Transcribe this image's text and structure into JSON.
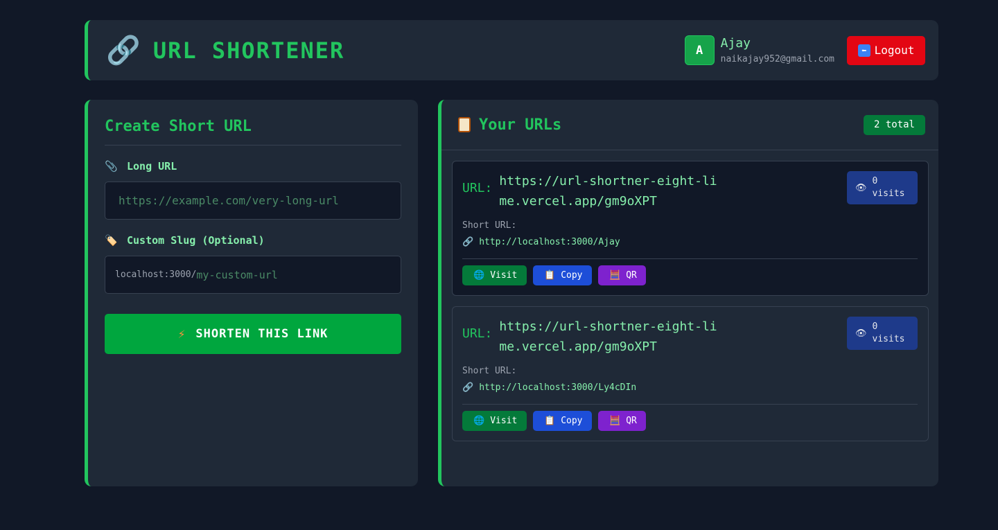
{
  "header": {
    "logo_icon": "🔗",
    "title": "URL SHORTENER",
    "user": {
      "avatar_initial": "A",
      "name": "Ajay",
      "email": "naikajay952@gmail.com"
    },
    "logout_label": "Logout",
    "logout_icon": "⬅"
  },
  "create": {
    "title": "Create Short URL",
    "long_url_label": "Long URL",
    "long_url_icon": "📎",
    "long_url_placeholder": "https://example.com/very-long-url",
    "slug_label": "Custom Slug (Optional)",
    "slug_icon": "🏷️",
    "slug_prefix": "localhost:3000/",
    "slug_placeholder": "my-custom-url",
    "submit_label": "SHORTEN THIS LINK",
    "submit_icon": "⚡"
  },
  "urls": {
    "title": "Your URLs",
    "total_badge": "2 total",
    "items": [
      {
        "url_prefix": "URL:",
        "long_url": "https://url-shortner-eight-lime.vercel.app/gm9oXPT",
        "visits_count": "0",
        "visits_label": "visits",
        "short_label": "Short URL:",
        "short_url": "http://localhost:3000/Ajay",
        "visit_label": "Visit",
        "copy_label": "Copy",
        "qr_label": "QR"
      },
      {
        "url_prefix": "URL:",
        "long_url": "https://url-shortner-eight-lime.vercel.app/gm9oXPT",
        "visits_count": "0",
        "visits_label": "visits",
        "short_label": "Short URL:",
        "short_url": "http://localhost:3000/Ly4cDIn",
        "visit_label": "Visit",
        "copy_label": "Copy",
        "qr_label": "QR"
      }
    ]
  },
  "colors": {
    "accent": "#22c55e",
    "background": "#111827",
    "panel": "#1f2937",
    "logout": "#e30613",
    "visit": "#047a3a",
    "copy": "#1d4ed8",
    "qr": "#7e22ce"
  }
}
